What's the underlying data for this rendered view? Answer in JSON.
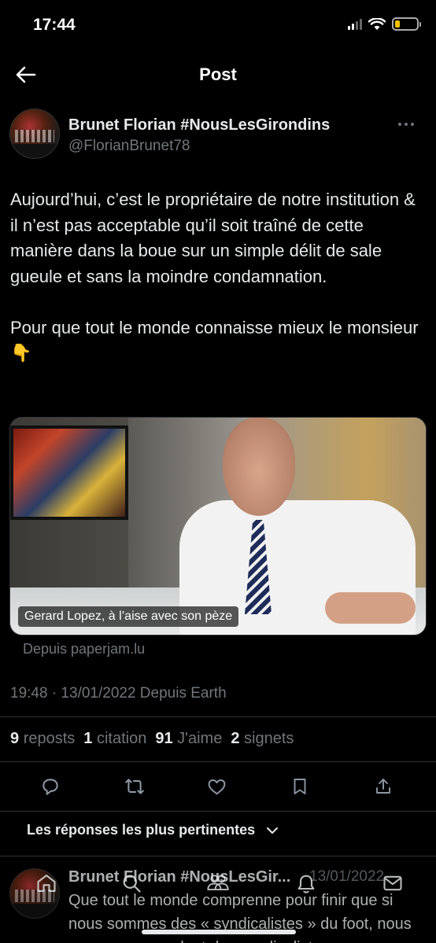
{
  "status_bar": {
    "time": "17:44"
  },
  "nav": {
    "title": "Post"
  },
  "post": {
    "author_name": "Brunet Florian #NousLesGirondins",
    "author_handle": "@FlorianBrunet78",
    "paragraph_1": "Aujourd’hui, c’est le propriétaire de notre institution & il n’est pas acceptable qu’il soit traîné de cette manière dans la boue sur un simple délit de sale gueule et sans la moindre condamnation.",
    "paragraph_2": "Pour que tout le monde connaisse mieux le monsieur",
    "emoji": "👇",
    "media_caption": "Gerard Lopez, à l’aise avec son pèze",
    "link_source": "Depuis paperjam.lu",
    "timestamp": "19:48 · 13/01/2022 Depuis Earth"
  },
  "stats": {
    "reposts_count": "9",
    "reposts_label": "reposts",
    "quotes_count": "1",
    "quotes_label": "citation",
    "likes_count": "91",
    "likes_label": "J'aime",
    "bookmarks_count": "2",
    "bookmarks_label": "signets"
  },
  "actions": [
    "reply-icon",
    "repost-icon",
    "like-icon",
    "bookmark-icon",
    "share-icon"
  ],
  "replies": {
    "sort_label": "Les réponses les plus pertinentes",
    "first": {
      "author_name": "Brunet Florian #NousLesGir...",
      "date": "13/01/2022",
      "text": "Que tout le monde comprenne pour finir que si nous sommes des « syndicalistes » du foot, nous sommes cependant des syndicalistes"
    }
  },
  "tabbar": [
    "home-icon",
    "search-icon",
    "communities-icon",
    "notifications-icon",
    "messages-icon"
  ],
  "colors": {
    "background": "#000000",
    "text": "#e7e9ea",
    "muted": "#71767b",
    "divider": "#2f3336"
  }
}
